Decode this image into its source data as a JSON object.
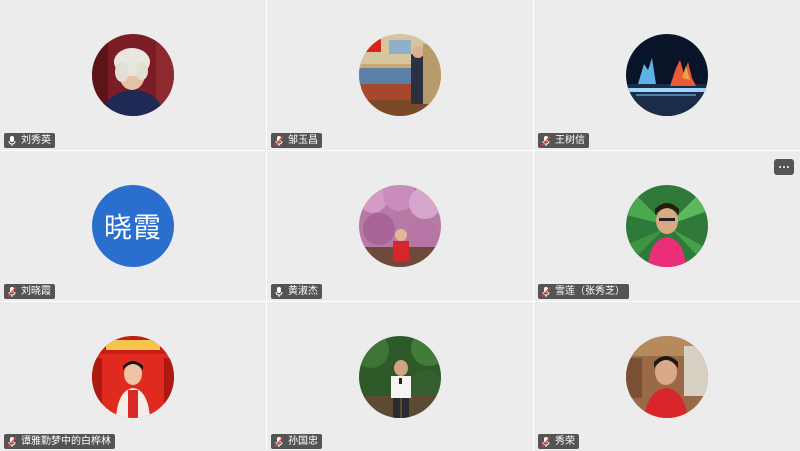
{
  "participants": [
    {
      "name": "刘秀英",
      "mic": "mic-icon"
    },
    {
      "name": "邹玉昌",
      "mic": "mic-muted-icon"
    },
    {
      "name": "王树信",
      "mic": "mic-muted-icon"
    },
    {
      "name": "刘晓霞",
      "mic": "mic-muted-icon",
      "avatar_text": "晓霞"
    },
    {
      "name": "黄淑杰",
      "mic": "mic-icon"
    },
    {
      "name": "雪莲（张秀芝）",
      "mic": "mic-muted-icon"
    },
    {
      "name": "谭雅勤梦中的白桦林",
      "mic": "mic-muted-icon"
    },
    {
      "name": "孙国忠",
      "mic": "mic-muted-icon"
    },
    {
      "name": "秀荣",
      "mic": "mic-muted-icon"
    }
  ],
  "more_button": "more-icon",
  "colors": {
    "tile_bg": "#ececec",
    "label_bg": "#323232",
    "text_avatar_bg": "#2a6fce",
    "muted_slash": "#e8413c"
  }
}
